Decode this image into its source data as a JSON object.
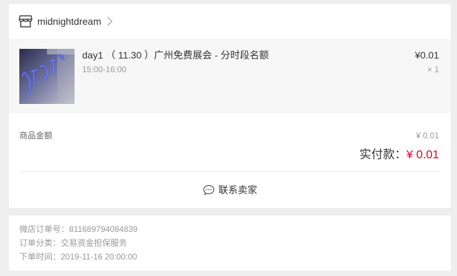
{
  "shop": {
    "name": "midnightdream",
    "icon": "shop-icon",
    "chevron": "chevron-right-icon"
  },
  "product": {
    "title": "day1 （ 11.30 ）广州免费展会 - 分时段名额",
    "time": "15:00-16:00",
    "price": "¥0.01",
    "quantity": "× 1"
  },
  "totals": {
    "goods_label": "商品金额",
    "goods_value": "¥ 0.01",
    "paid_label": "实付款：",
    "paid_value": "¥ 0.01"
  },
  "contact": {
    "label": "联系卖家",
    "icon": "chat-icon"
  },
  "meta": {
    "order_no": "微店订单号：811689794084839",
    "category": "订单分类：交易资金担保服务",
    "order_time": "下单时间：2019-11-16 20:00:00"
  },
  "colors": {
    "accent": "#e4002b",
    "background": "#eeeeee",
    "product_bg": "#f7f7f7"
  }
}
